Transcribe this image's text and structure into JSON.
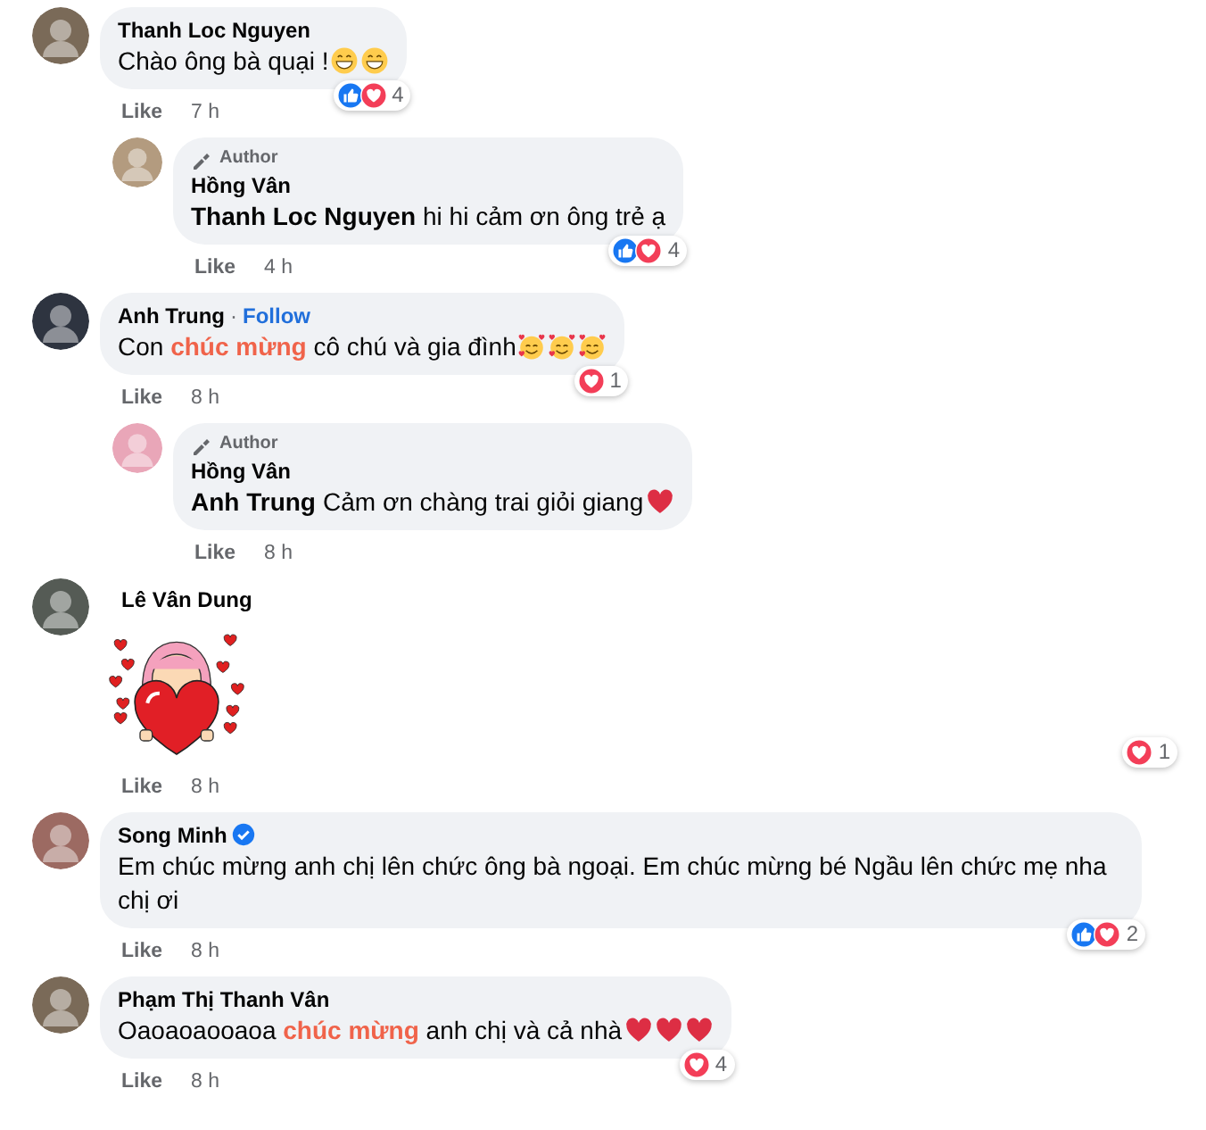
{
  "comments": [
    {
      "author": "Thanh Loc Nguyen",
      "text": "Chào ông bà quại !",
      "emojis": [
        {
          "kind": "grin"
        },
        {
          "kind": "grin"
        }
      ],
      "reactions": {
        "icons": [
          {
            "kind": "like"
          },
          {
            "kind": "love"
          }
        ],
        "count": "4"
      },
      "like": "Like",
      "time": "7 h",
      "replies": [
        {
          "badge": "Author",
          "author": "Hồng Vân",
          "mention": "Thanh Loc Nguyen",
          "text": "hi hi cảm ơn ông trẻ ạ",
          "reactions": {
            "icons": [
              {
                "kind": "like"
              },
              {
                "kind": "love"
              }
            ],
            "count": "4"
          },
          "like": "Like",
          "time": "4 h"
        }
      ]
    },
    {
      "author": "Anh Trung",
      "follow": {
        "separator": "·",
        "label": "Follow"
      },
      "text": "Con **chúc mừng** cô chú và gia đình",
      "emojis": [
        {
          "kind": "hearts-smile"
        },
        {
          "kind": "hearts-smile"
        },
        {
          "kind": "hearts-smile"
        }
      ],
      "reactions": {
        "icons": [
          {
            "kind": "love"
          }
        ],
        "count": "1"
      },
      "like": "Like",
      "time": "8 h",
      "replies": [
        {
          "badge": "Author",
          "author": "Hồng Vân",
          "mention": "Anh Trung",
          "text": "Cảm ơn chàng trai giỏi giang",
          "emojis": [
            {
              "kind": "heart"
            }
          ],
          "like": "Like",
          "time": "8 h"
        }
      ]
    },
    {
      "author": "Lê Vân Dung",
      "attachment": {
        "kind": "sticker"
      },
      "reactions": {
        "icons": [
          {
            "kind": "love"
          }
        ],
        "count": "1"
      },
      "like": "Like",
      "time": "8 h"
    },
    {
      "author": "Song Minh",
      "verified": true,
      "text": "Em chúc mừng anh chị lên chức ông bà ngoại. Em chúc mừng bé Ngầu lên chức mẹ nha chị ơi",
      "reactions": {
        "icons": [
          {
            "kind": "like"
          },
          {
            "kind": "love"
          }
        ],
        "count": "2"
      },
      "like": "Like",
      "time": "8 h"
    },
    {
      "author": "Phạm Thị Thanh Vân",
      "text": "Oaoaoaooaoa **chúc mừng** anh chị và cả nhà",
      "emojis": [
        {
          "kind": "heart"
        },
        {
          "kind": "heart"
        },
        {
          "kind": "heart"
        }
      ],
      "reactions": {
        "icons": [
          {
            "kind": "love"
          }
        ],
        "count": "4"
      },
      "like": "Like",
      "time": "8 h"
    }
  ]
}
